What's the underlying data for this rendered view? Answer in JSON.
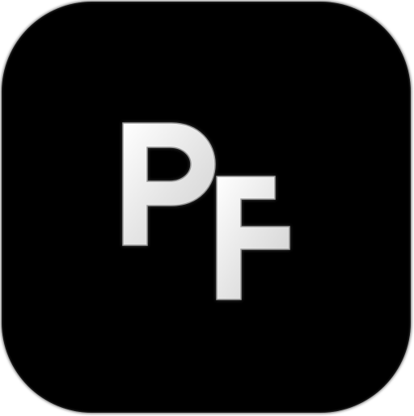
{
  "app_icon": {
    "monogram_letters": [
      "P",
      "F"
    ],
    "monogram_text": "PF",
    "tile_color": "#000000",
    "letter_color": "#f2f2f2"
  }
}
